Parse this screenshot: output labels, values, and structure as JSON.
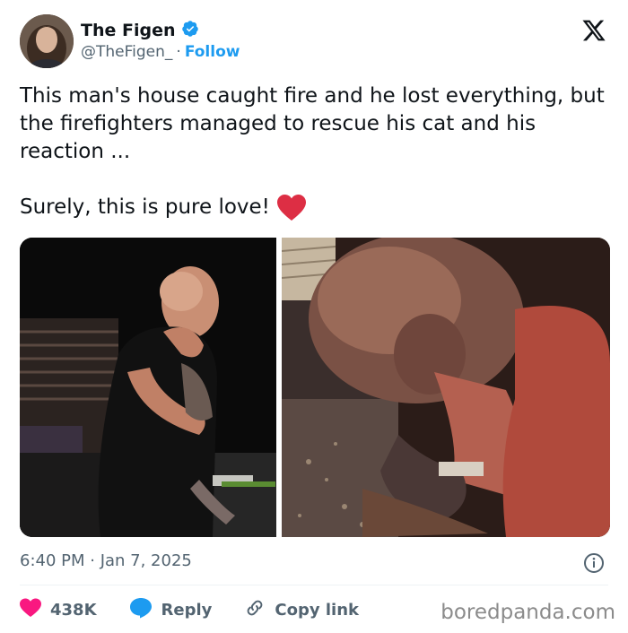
{
  "author": {
    "display_name": "The Figen",
    "handle": "@TheFigen_",
    "separator": "·",
    "follow_label": "Follow"
  },
  "tweet": {
    "line1": "This man's house caught fire and he lost everything, but the firefighters managed to rescue his cat and his reaction ...",
    "line2": "Surely, this is pure love!",
    "timestamp": "6:40 PM · Jan 7, 2025"
  },
  "actions": {
    "likes": "438K",
    "reply_label": "Reply",
    "copy_label": "Copy link"
  },
  "watermark": "boredpanda.com",
  "colors": {
    "accent": "#1d9bf0",
    "like": "#f91880",
    "muted": "#536471"
  },
  "icons": [
    "verified-badge-icon",
    "x-logo-icon",
    "heart-emoji-icon",
    "info-icon",
    "heart-icon",
    "reply-bubble-icon",
    "link-icon"
  ]
}
